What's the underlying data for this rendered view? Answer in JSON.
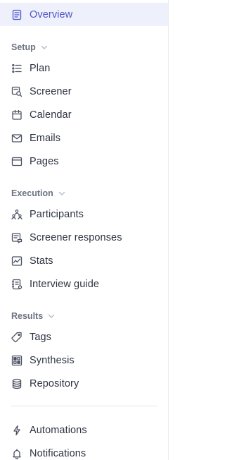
{
  "nav": {
    "overview": {
      "label": "Overview",
      "icon": "document-icon",
      "active": true
    },
    "setup": {
      "title": "Setup",
      "items": [
        {
          "label": "Plan",
          "icon": "list-icon"
        },
        {
          "label": "Screener",
          "icon": "screener-icon"
        },
        {
          "label": "Calendar",
          "icon": "calendar-icon"
        },
        {
          "label": "Emails",
          "icon": "mail-icon"
        },
        {
          "label": "Pages",
          "icon": "browser-window-icon"
        }
      ]
    },
    "execution": {
      "title": "Execution",
      "items": [
        {
          "label": "Participants",
          "icon": "people-icon"
        },
        {
          "label": "Screener responses",
          "icon": "responses-icon"
        },
        {
          "label": "Stats",
          "icon": "chart-line-icon"
        },
        {
          "label": "Interview guide",
          "icon": "guide-icon"
        }
      ]
    },
    "results": {
      "title": "Results",
      "items": [
        {
          "label": "Tags",
          "icon": "tag-icon"
        },
        {
          "label": "Synthesis",
          "icon": "synthesis-icon"
        },
        {
          "label": "Repository",
          "icon": "database-icon"
        }
      ]
    },
    "bottom": {
      "items": [
        {
          "label": "Automations",
          "icon": "lightning-icon"
        },
        {
          "label": "Notifications",
          "icon": "bell-icon"
        }
      ]
    }
  },
  "colors": {
    "accent": "#4c55c9",
    "active_bg": "#eef0fb",
    "text": "#2d3340",
    "section_text": "#6b7282",
    "icon": "#4a5060"
  }
}
